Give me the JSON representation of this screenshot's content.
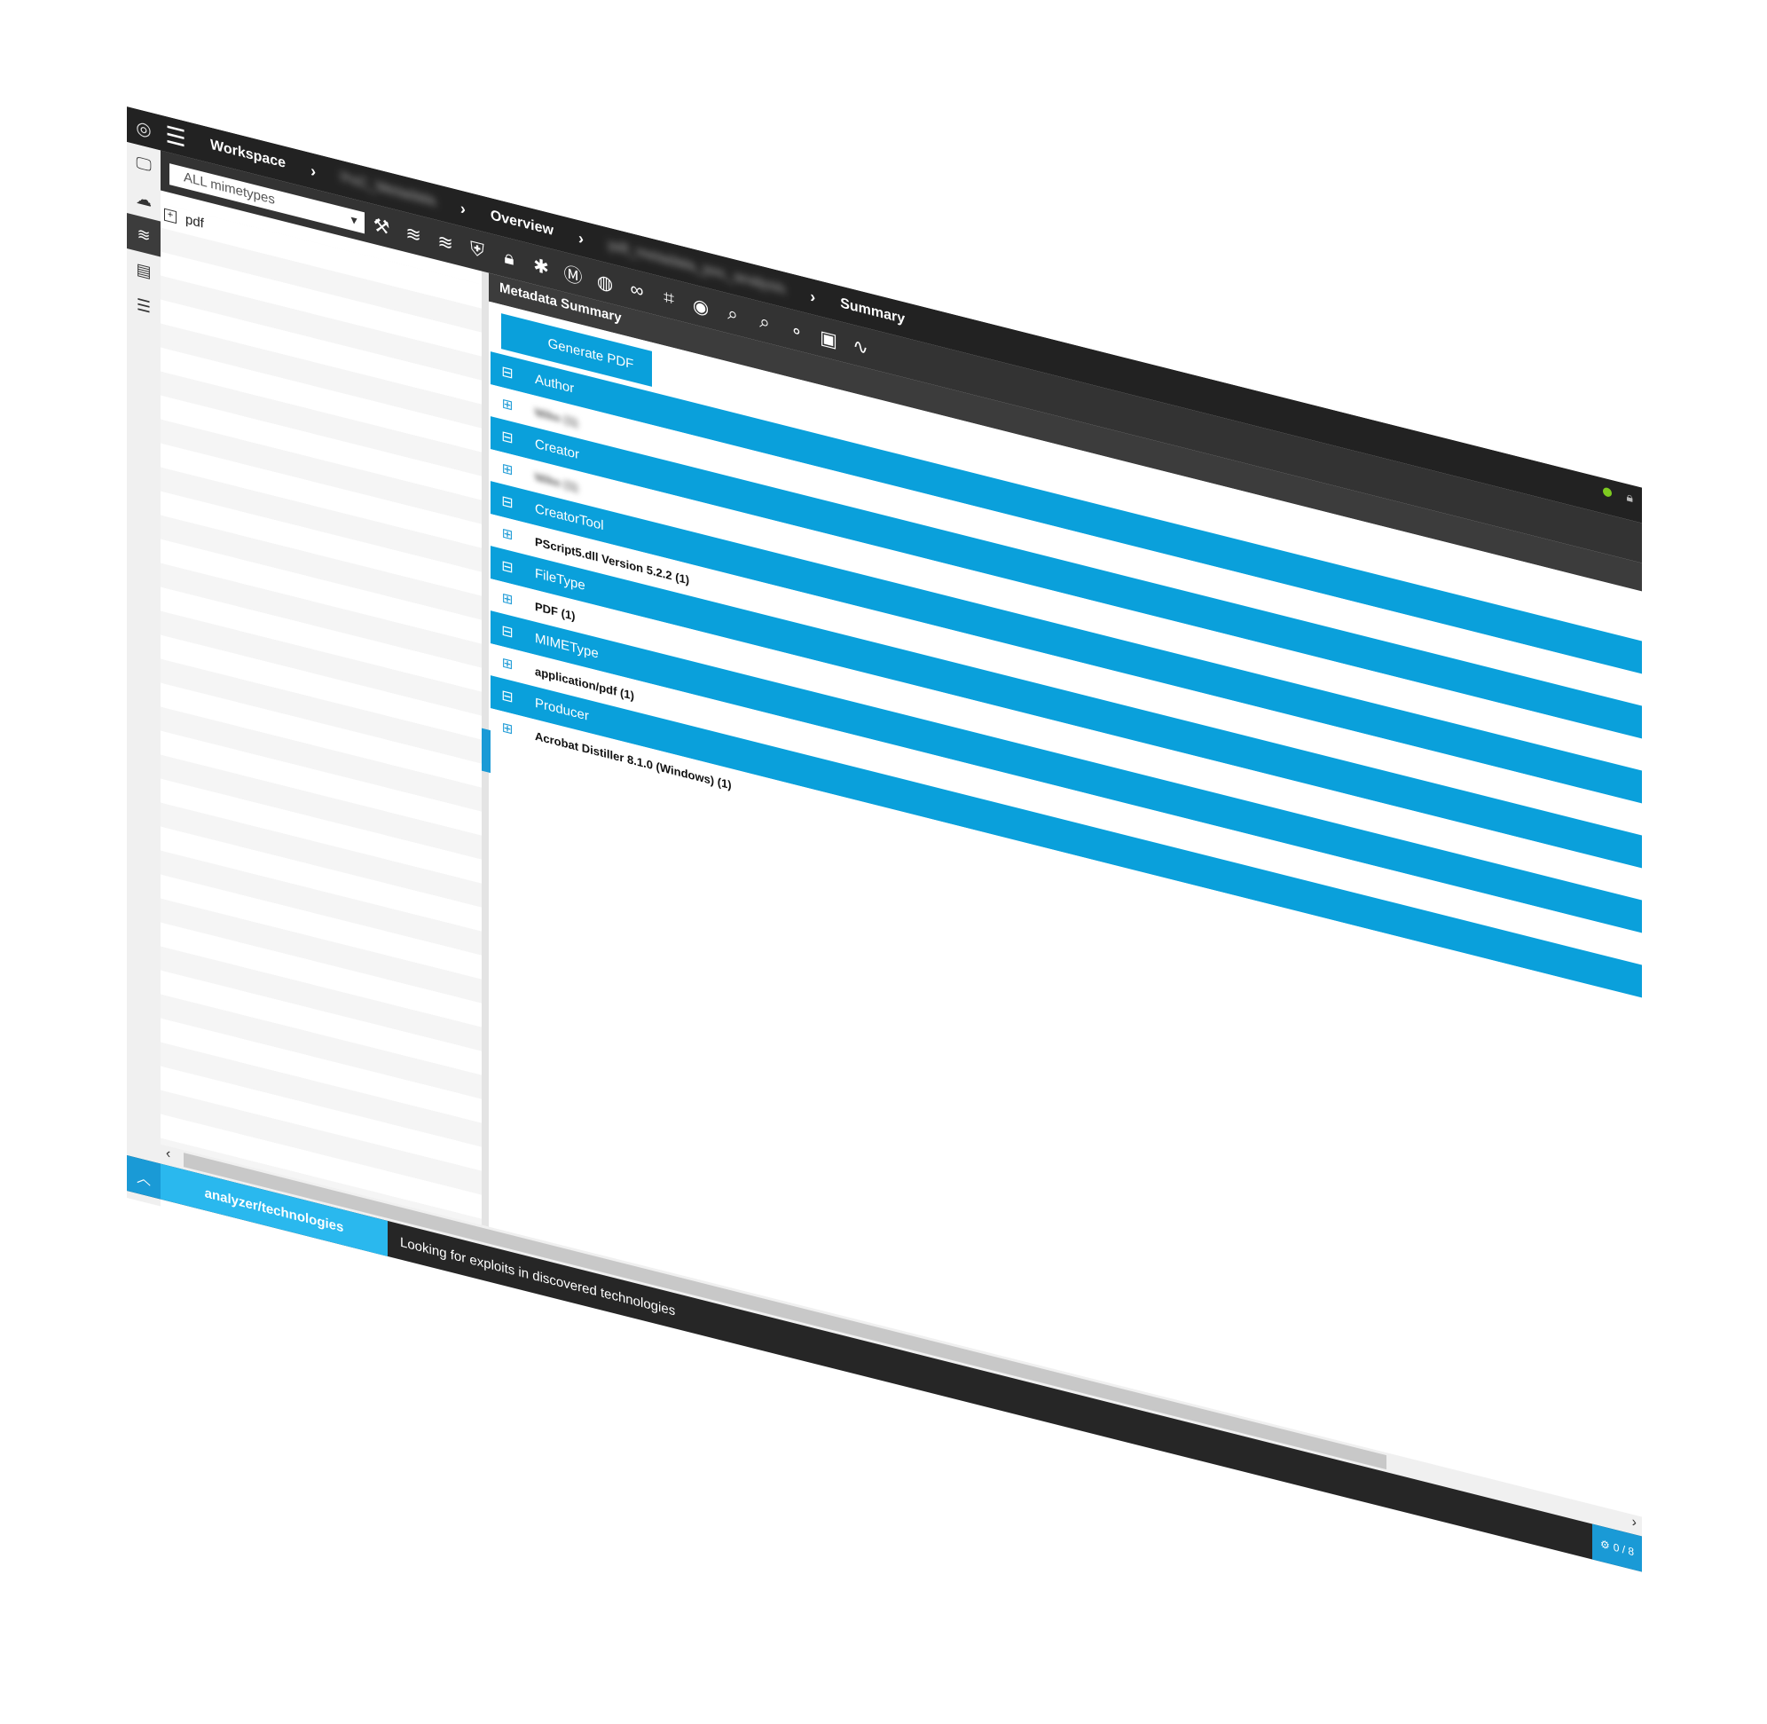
{
  "header": {
    "breadcrumbs": [
      {
        "label": "Workspace",
        "blurred": false
      },
      {
        "label": "PoC_Metadata",
        "blurred": true
      },
      {
        "label": "Overview",
        "blurred": false
      },
      {
        "label": "pdf_metadata_poc_analysis",
        "blurred": true
      },
      {
        "label": "Summary",
        "blurred": false
      }
    ],
    "status_color": "#7ecb20"
  },
  "toolbar": {
    "icons": [
      "refresh-icon",
      "database-icon",
      "database-icon",
      "database-icon",
      "cloud-icon",
      "cloud-icon",
      "hammer-icon",
      "layers-icon",
      "layers-icon",
      "shield-icon",
      "lock-icon",
      "bug-icon",
      "metasploit-icon",
      "globe-icon",
      "binoculars-icon",
      "crop-icon",
      "dns-icon",
      "search-icon",
      "search-icon",
      "link-icon",
      "inbox-icon",
      "pulse-icon"
    ],
    "mimetype_filter": "ALL mimetypes"
  },
  "tree": {
    "items": [
      {
        "label": "pdf"
      }
    ]
  },
  "main": {
    "title": "Metadata Summary",
    "generate_pdf_label": "Generate PDF",
    "groups": [
      {
        "name": "Author",
        "items": [
          {
            "label": "Mike (1)",
            "blurred": true
          }
        ]
      },
      {
        "name": "Creator",
        "items": [
          {
            "label": "Mike (1)",
            "blurred": true
          }
        ]
      },
      {
        "name": "CreatorTool",
        "items": [
          {
            "label": "PScript5.dll Version 5.2.2 (1)",
            "blurred": false
          }
        ]
      },
      {
        "name": "FileType",
        "items": [
          {
            "label": "PDF (1)",
            "blurred": false
          }
        ]
      },
      {
        "name": "MIMEType",
        "items": [
          {
            "label": "application/pdf (1)",
            "blurred": false
          }
        ]
      },
      {
        "name": "Producer",
        "items": [
          {
            "label": "Acrobat Distiller 8.1.0 (Windows) (1)",
            "blurred": false
          }
        ]
      }
    ]
  },
  "statusbar": {
    "task": "analyzer/technologies",
    "message": "Looking for exploits in discovered technologies",
    "count": "0 / 8"
  },
  "colors": {
    "accent": "#0aa0db",
    "topbar": "#222222",
    "toolbar": "#333333"
  }
}
